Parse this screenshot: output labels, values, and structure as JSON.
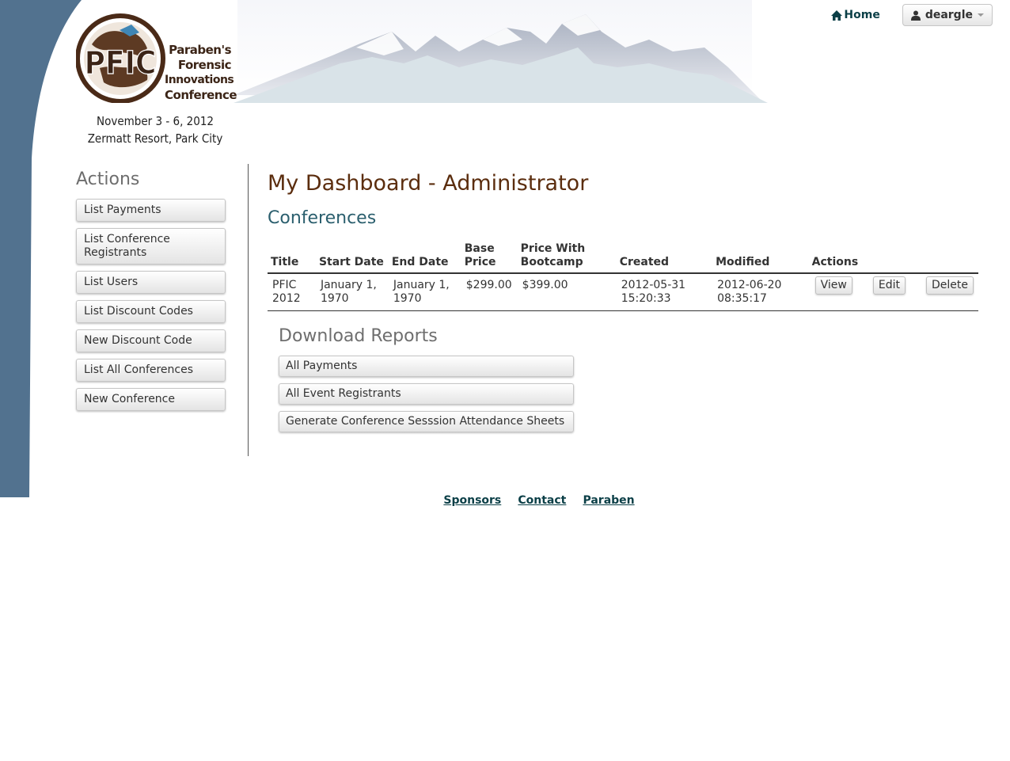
{
  "header": {
    "logo_mark": "PFIC",
    "logo_title_lines": [
      "Paraben's",
      "Forensic",
      "Innovations",
      "Conference"
    ],
    "dates_line": "November 3 - 6, 2012",
    "venue_line": "Zermatt Resort, Park City",
    "home_label": "Home",
    "user_label": "deargle"
  },
  "sidebar": {
    "heading": "Actions",
    "items": [
      {
        "label": "List Payments"
      },
      {
        "label": "List Conference Registrants"
      },
      {
        "label": "List Users"
      },
      {
        "label": "List Discount Codes"
      },
      {
        "label": "New Discount Code"
      },
      {
        "label": "List All Conferences"
      },
      {
        "label": "New Conference"
      }
    ]
  },
  "main": {
    "title": "My Dashboard - Administrator",
    "section_title": "Conferences",
    "table": {
      "headers": [
        "Title",
        "Start Date",
        "End Date",
        "Base Price",
        "Price With Bootcamp",
        "Created",
        "Modified",
        "Actions"
      ],
      "rows": [
        {
          "title": "PFIC 2012",
          "start_date": "January 1, 1970",
          "end_date": "January 1, 1970",
          "base_price": "$299.00",
          "price_with_bootcamp": "$399.00",
          "created": "2012-05-31 15:20:33",
          "modified": "2012-06-20 08:35:17",
          "actions": [
            "View",
            "Edit",
            "Delete"
          ]
        }
      ]
    },
    "reports": {
      "heading": "Download Reports",
      "buttons": [
        "All Payments",
        "All Event Registrants",
        "Generate Conference Sesssion Attendance Sheets"
      ]
    }
  },
  "footer": {
    "links": [
      "Sponsors",
      "Contact",
      "Paraben"
    ]
  },
  "colors": {
    "side_band": "#52728f",
    "heading_brown": "#5b2d0e",
    "section_teal": "#2b5f6e",
    "link": "#0b3f47"
  }
}
